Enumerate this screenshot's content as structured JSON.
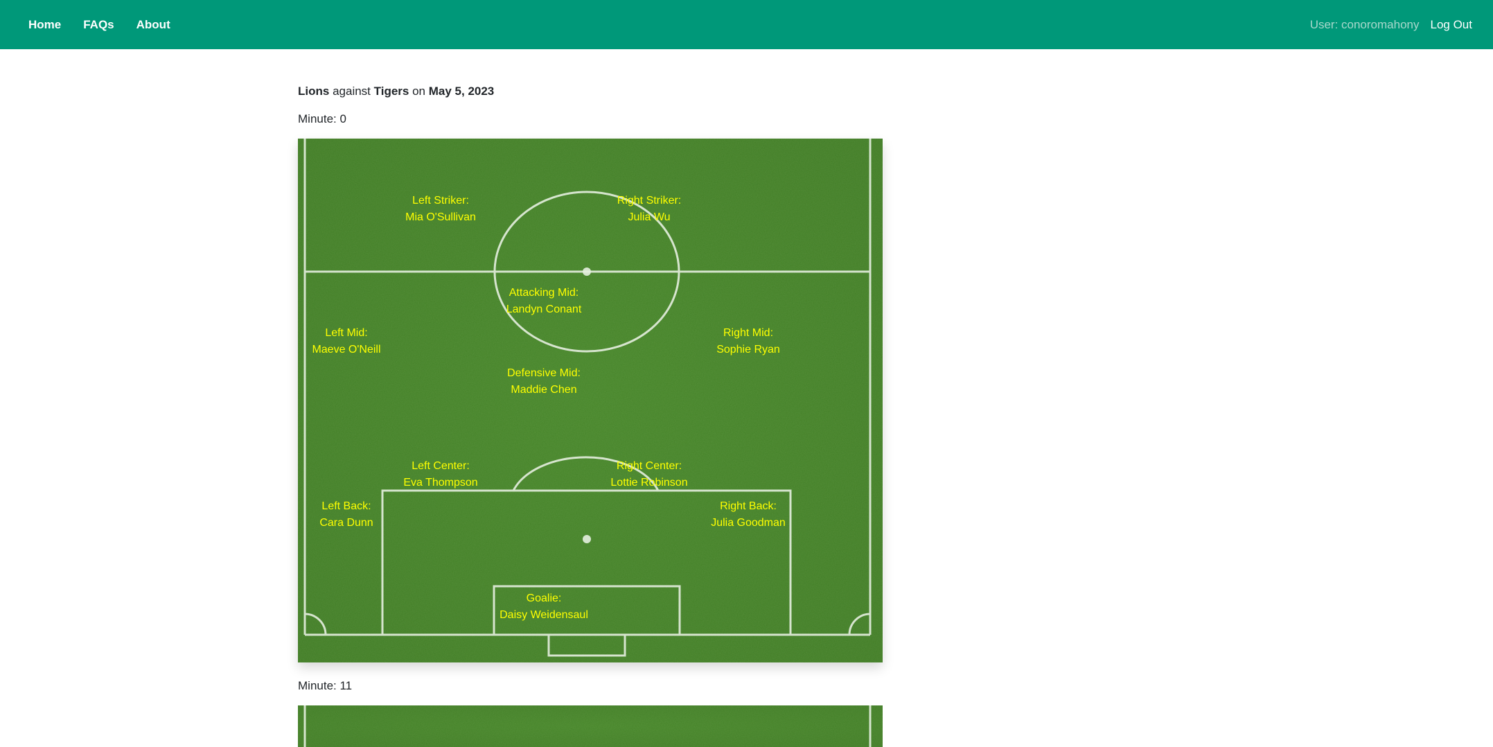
{
  "nav": {
    "home": "Home",
    "faqs": "FAQs",
    "about": "About",
    "user": "User: conoromahony",
    "logout": "Log Out"
  },
  "match": {
    "team": "Lions",
    "against": "against",
    "opponent": "Tigers",
    "on": "on",
    "date": "May 5, 2023"
  },
  "lineups": [
    {
      "minute_label": "Minute: 0",
      "players": [
        {
          "role": "Left Striker:",
          "name": "Mia O'Sullivan"
        },
        {
          "role": "Right Striker:",
          "name": "Julia Wu"
        },
        {
          "role": "Attacking Mid:",
          "name": "Landyn Conant"
        },
        {
          "role": "Left Mid:",
          "name": "Maeve O'Neill"
        },
        {
          "role": "Right Mid:",
          "name": "Sophie Ryan"
        },
        {
          "role": "Defensive Mid:",
          "name": "Maddie Chen"
        },
        {
          "role": "Left Center:",
          "name": "Eva Thompson"
        },
        {
          "role": "Right Center:",
          "name": "Lottie Robinson"
        },
        {
          "role": "Left Back:",
          "name": "Cara Dunn"
        },
        {
          "role": "Right Back:",
          "name": "Julia Goodman"
        },
        {
          "role": "Goalie:",
          "name": "Daisy Weidensaul"
        }
      ]
    },
    {
      "minute_label": "Minute: 11"
    }
  ],
  "colors": {
    "navbar": "#009879",
    "player_text": "#ffff00",
    "grass": "#3f7f22"
  }
}
